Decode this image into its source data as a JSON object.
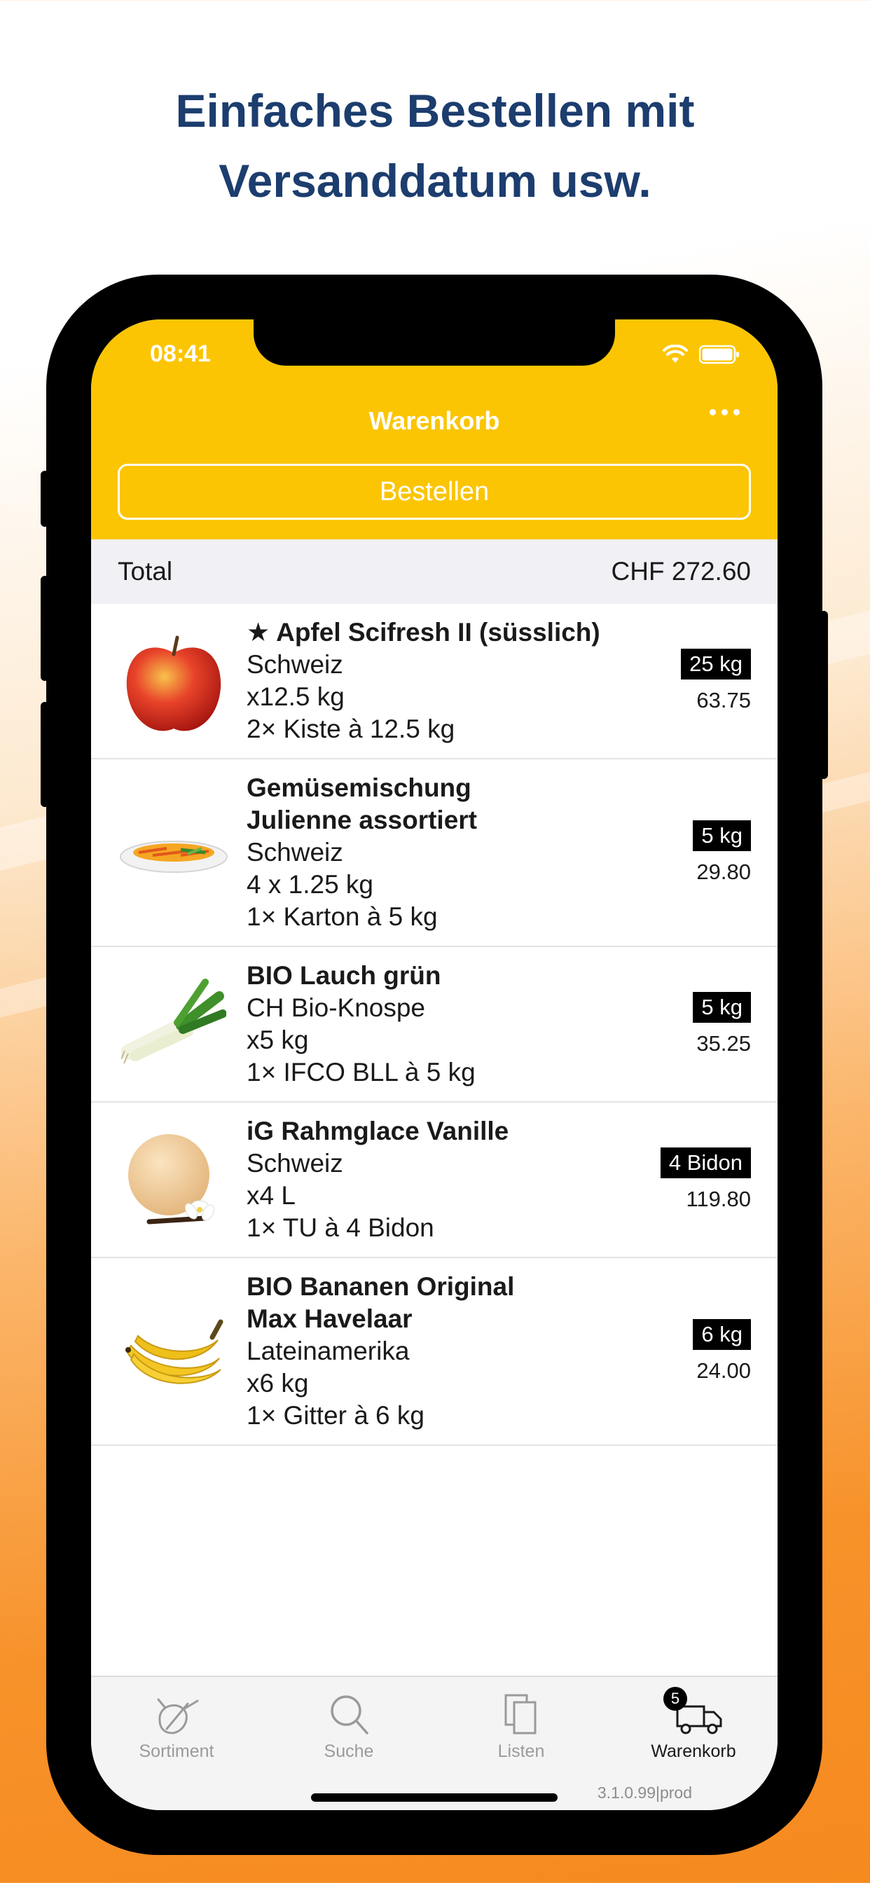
{
  "headline": {
    "line1": "Einfaches Bestellen mit",
    "line2": "Versanddatum usw."
  },
  "status_bar": {
    "time": "08:41",
    "icons": [
      "wifi-icon",
      "battery-icon"
    ]
  },
  "nav": {
    "title": "Warenkorb",
    "more_icon": "ellipsis-icon"
  },
  "order_button": "Bestellen",
  "total": {
    "label": "Total",
    "value": "CHF 272.60"
  },
  "items": [
    {
      "star": "★",
      "name": "Apfel Scifresh II (süsslich)",
      "origin": "Schweiz",
      "quantity": "x12.5 kg",
      "pack": "2× Kiste à 12.5 kg",
      "badge": "25 kg",
      "price": "63.75",
      "image": "apple"
    },
    {
      "name_line1": "Gemüsemischung",
      "name_line2": "Julienne assortiert",
      "origin": "Schweiz",
      "quantity": "4 x 1.25 kg",
      "pack": "1× Karton à 5 kg",
      "badge": "5 kg",
      "price": "29.80",
      "image": "vegetable-mix"
    },
    {
      "name": "BIO Lauch grün",
      "origin": "CH Bio-Knospe",
      "quantity": "x5 kg",
      "pack": "1× IFCO BLL à 5 kg",
      "badge": "5 kg",
      "price": "35.25",
      "image": "leek"
    },
    {
      "name": "iG Rahmglace Vanille",
      "origin": "Schweiz",
      "quantity": "x4 L",
      "pack": "1× TU à 4 Bidon",
      "badge": "4 Bidon",
      "price": "119.80",
      "image": "ice-cream"
    },
    {
      "name_line1": "BIO Bananen Original",
      "name_line2": "Max Havelaar",
      "origin": "Lateinamerika",
      "quantity": "x6 kg",
      "pack": "1× Gitter à 6 kg",
      "badge": "6 kg",
      "price": "24.00",
      "image": "bananas"
    }
  ],
  "tabs": [
    {
      "label": "Sortiment",
      "icon": "produce-icon",
      "active": false
    },
    {
      "label": "Suche",
      "icon": "search-icon",
      "active": false
    },
    {
      "label": "Listen",
      "icon": "lists-icon",
      "active": false
    },
    {
      "label": "Warenkorb",
      "icon": "delivery-truck-icon",
      "active": true,
      "badge": "5"
    }
  ],
  "version": "3.1.0.99|prod",
  "colors": {
    "header_yellow": "#fbc504",
    "headline_blue": "#1c3d6e",
    "background_orange": "#f7922a"
  }
}
